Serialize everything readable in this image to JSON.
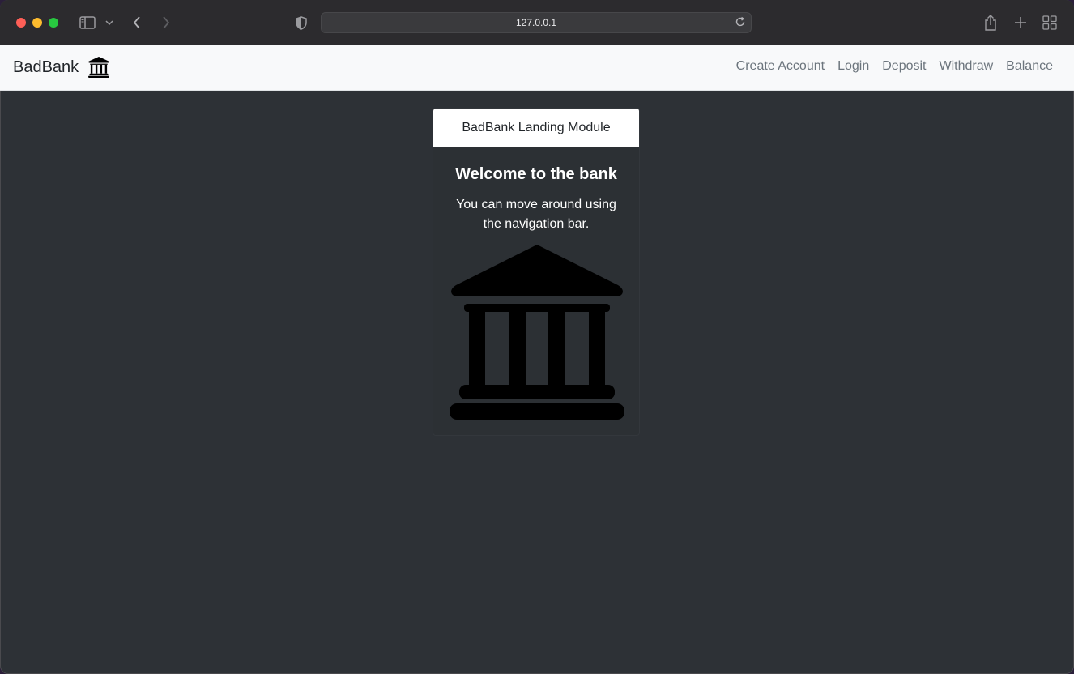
{
  "browser": {
    "url": "127.0.0.1"
  },
  "navbar": {
    "brand": "BadBank",
    "links": [
      "Create Account",
      "Login",
      "Deposit",
      "Withdraw",
      "Balance"
    ]
  },
  "card": {
    "header": "BadBank Landing Module",
    "title": "Welcome to the bank",
    "text": "You can move around using the navigation bar.",
    "image_icon": "bank-icon"
  },
  "colors": {
    "navbar_bg": "#f8f9fa",
    "page_bg": "#2d3136",
    "nav_link": "#6c757d",
    "card_header_bg": "#ffffff"
  }
}
